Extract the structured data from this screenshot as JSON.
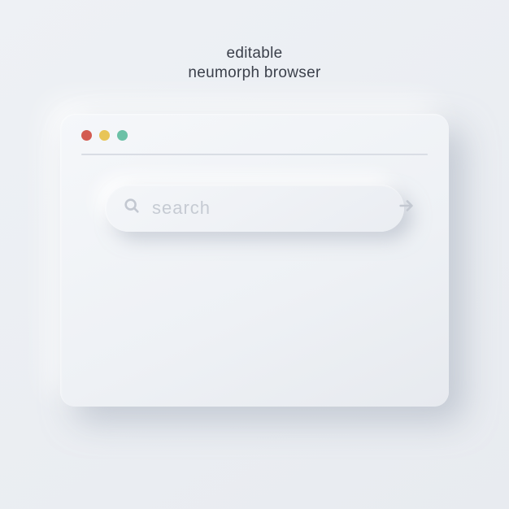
{
  "heading": {
    "line1": "editable",
    "line2": "neumorph browser"
  },
  "window": {
    "controls": {
      "close": "close",
      "minimize": "minimize",
      "maximize": "maximize"
    }
  },
  "search": {
    "placeholder": "search",
    "value": ""
  },
  "colors": {
    "close": "#d35b51",
    "minimize": "#e8c557",
    "maximize": "#6bc1a6",
    "background": "#eef1f5"
  }
}
